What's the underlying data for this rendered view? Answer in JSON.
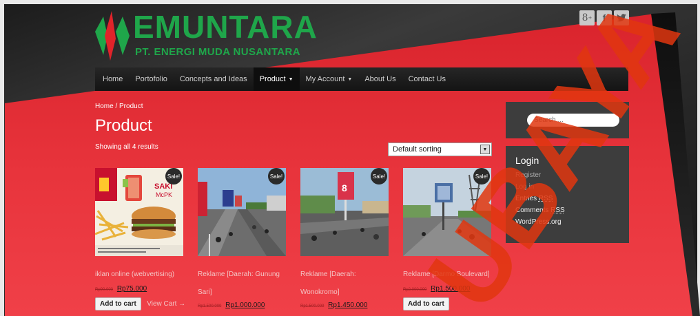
{
  "brand": {
    "name": "EMUNTARA",
    "tagline": "PT. ENERGI MUDA NUSANTARA",
    "color": "#1fa64a"
  },
  "social": [
    {
      "icon": "google-plus-icon",
      "glyph": "8⁺"
    },
    {
      "icon": "facebook-icon",
      "glyph": "f"
    },
    {
      "icon": "twitter-icon",
      "glyph": "🐦"
    }
  ],
  "nav": {
    "items": [
      {
        "label": "Home"
      },
      {
        "label": "Portofolio"
      },
      {
        "label": "Concepts and Ideas"
      },
      {
        "label": "Product"
      },
      {
        "label": "My Account"
      },
      {
        "label": "About Us"
      },
      {
        "label": "Contact Us"
      }
    ]
  },
  "breadcrumb": "Home / Product",
  "page_title": "Product",
  "result_count": "Showing all 4 results",
  "sort": {
    "selected": "Default sorting"
  },
  "products": [
    {
      "name": "iklan online (webvertising)",
      "sale_label": "Sale!",
      "old_price": "Rp90.000",
      "price": "Rp75.000",
      "add_to_cart": "Add to cart",
      "view_cart": "View Cart →"
    },
    {
      "name": "Reklame [Daerah: Gunung Sari]",
      "sale_label": "Sale!",
      "old_price": "Rp1.500.000",
      "price": "Rp1.000.000"
    },
    {
      "name": "Reklame [Daerah: Wonokromo]",
      "sale_label": "Sale!",
      "old_price": "Rp1.500.000",
      "price": "Rp1.450.000"
    },
    {
      "name": "Reklame [Darmo Boulevard]",
      "sale_label": "Sale!",
      "old_price": "Rp2.000.000",
      "price": "Rp1.500.000",
      "add_to_cart": "Add to cart"
    }
  ],
  "sidebar": {
    "search_placeholder": "Search ...",
    "login": {
      "title": "Login",
      "register": "Register",
      "login": "Log in",
      "entries_prefix": "Entries ",
      "entries_abbr": "RSS",
      "comments_prefix": "Comments ",
      "comments_abbr": "RSS",
      "wordpress": "WordPress.org"
    }
  },
  "watermark": "UBAYA",
  "colors": {
    "accent": "#e8343c",
    "dark": "#1c1c1c",
    "watermark": "#e0360f"
  }
}
